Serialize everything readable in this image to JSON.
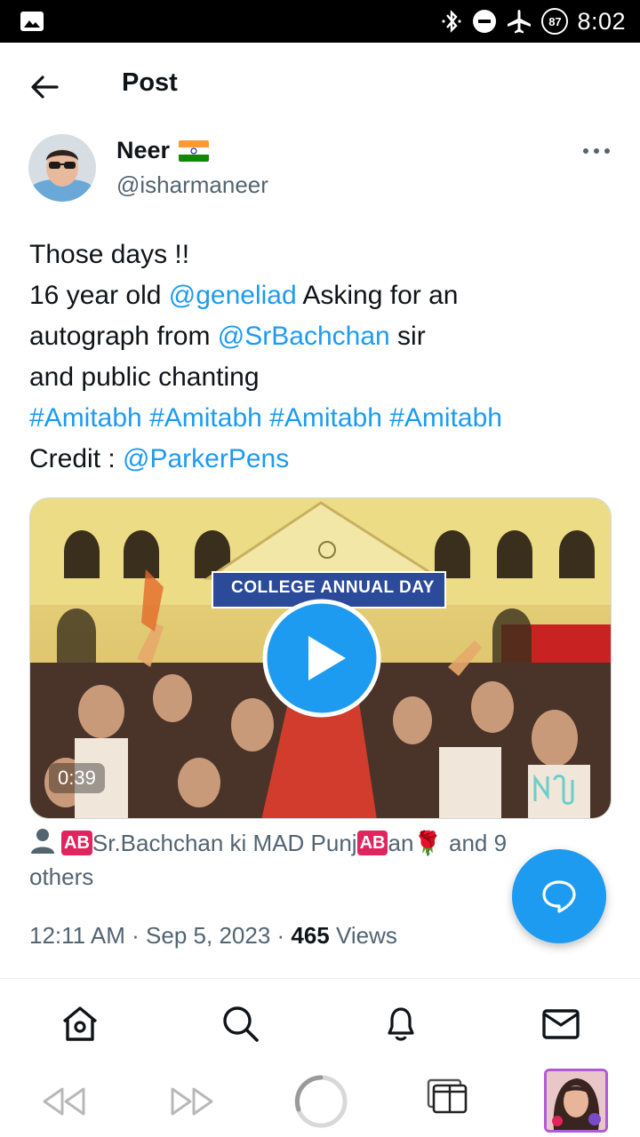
{
  "status_bar": {
    "time": "8:02",
    "battery": "87"
  },
  "header": {
    "title": "Post"
  },
  "author": {
    "name": "Neer",
    "handle": "@isharmaneer"
  },
  "post": {
    "line1": "Those days !!",
    "line2_a": "16 year old ",
    "line2_mention": "@geneliad",
    "line2_b": " Asking for an",
    "line3_a": "autograph from ",
    "line3_mention": "@SrBachchan",
    "line3_b": " sir",
    "line4": "and public chanting",
    "hashtags": "#Amitabh #Amitabh #Amitabh #Amitabh",
    "credit_label": "Credit : ",
    "credit_mention": "@ParkerPens"
  },
  "media": {
    "banner": "COLLEGE ANNUAL DAY",
    "duration": "0:39"
  },
  "liked_by": {
    "badge1": "AB",
    "text1": "Sr.Bachchan ki MAD Punj",
    "badge2": "AB",
    "text2": "an",
    "emoji": "🌹",
    "text3": " and 9 others"
  },
  "meta": {
    "time": "12:11 AM",
    "sep1": " · ",
    "date": "Sep 5, 2023",
    "sep2": " · ",
    "views_count": "465",
    "views_label": " Views"
  },
  "colors": {
    "accent": "#1d9bf0",
    "text": "#0f1419",
    "secondary": "#536471"
  },
  "bottom_nav": [
    "home-icon",
    "search-icon",
    "notifications-icon",
    "messages-icon"
  ],
  "browser_bar": [
    "back-icon",
    "forward-icon",
    "reload-icon",
    "tabs-icon",
    "tab-thumbnail"
  ]
}
